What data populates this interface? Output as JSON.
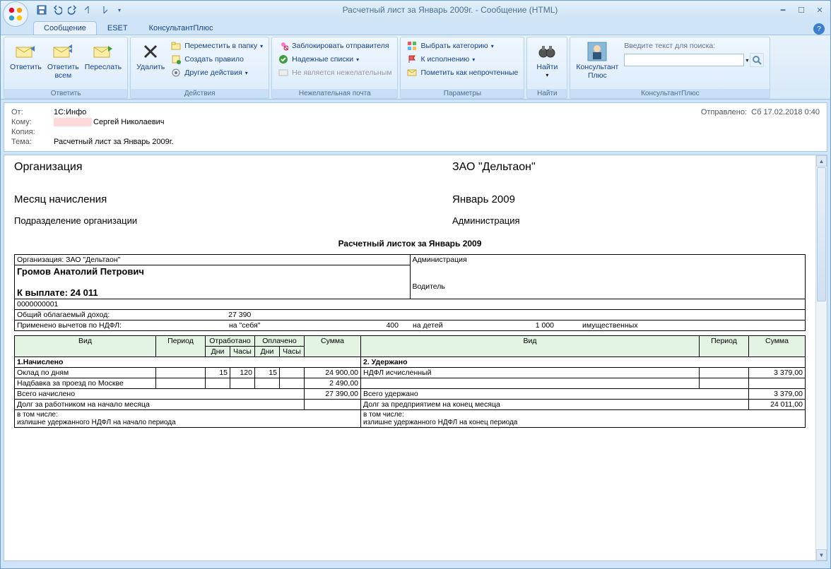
{
  "window": {
    "title": "Расчетный лист за Январь 2009г. - Сообщение (HTML)"
  },
  "tabs": {
    "msg": "Сообщение",
    "eset": "ESET",
    "kplus": "КонсультантПлюс"
  },
  "ribbon": {
    "reply_group": "Ответить",
    "reply": "Ответить",
    "reply_all": "Ответить\nвсем",
    "forward": "Переслать",
    "actions_group": "Действия",
    "delete": "Удалить",
    "move_folder": "Переместить в папку",
    "create_rule": "Создать правило",
    "other_actions": "Другие действия",
    "junk_group": "Нежелательная почта",
    "block_sender": "Заблокировать отправителя",
    "safe_lists": "Надежные списки",
    "not_junk": "Не является нежелательным",
    "params_group": "Параметры",
    "categorize": "Выбрать категорию",
    "followup": "К исполнению",
    "mark_unread": "Пометить как непрочтенные",
    "find_group": "Найти",
    "find": "Найти",
    "kplus_group": "КонсультантПлюс",
    "kplus_btn": "Консультант\nПлюс",
    "search_label": "Введите текст для поиска:"
  },
  "header": {
    "from_label": "От:",
    "from": "1С:Инфо",
    "to_label": "Кому:",
    "to_suffix": "Сергей Николаевич",
    "cc_label": "Копия:",
    "subject_label": "Тема:",
    "subject": "Расчетный лист за Январь 2009г.",
    "sent_label": "Отправлено:",
    "sent": "Сб 17.02.2018 0:40"
  },
  "doc": {
    "org_label": "Организация",
    "org": "ЗАО \"Дельтаон\"",
    "month_label": "Месяц начисления",
    "month": "Январь 2009",
    "dept_label": "Подразделение организации",
    "dept": "Администрация",
    "title": "Расчетный листок за Январь 2009",
    "org_line": "Организация: ЗАО \"Дельтаон\"",
    "dept2": "Администрация",
    "employee": "Громов Анатолий Петрович",
    "payout": "К выплате: 24 011",
    "position": "Водитель",
    "tabnum": "0000000001",
    "taxable_label": "Общий облагаемый доход:",
    "taxable": "27 390",
    "deduct_label": "Применено вычетов по НДФЛ:",
    "deduct_self_label": "на \"себя\"",
    "deduct_self": "400",
    "deduct_children_label": "на детей",
    "deduct_children": "1 000",
    "deduct_property_label": "имущественных",
    "col_type": "Вид",
    "col_period": "Период",
    "col_worked": "Отработано",
    "col_paid": "Оплачено",
    "col_days": "Дни",
    "col_hours": "Часы",
    "col_sum": "Сумма",
    "sec_accrued": "1.Начислено",
    "sec_withheld": "2. Удержано",
    "row_salary": "Оклад по дням",
    "row_salary_days": "15",
    "row_salary_hours": "120",
    "row_salary_pdays": "15",
    "row_salary_sum": "24 900,00",
    "row_ndfl": "НДФЛ исчисленный",
    "row_ndfl_sum": "3 379,00",
    "row_allowance": "Надбавка за проезд по Москве",
    "row_allowance_sum": "2 490,00",
    "row_total_accrued": "Всего начислено",
    "row_total_accrued_sum": "27 390,00",
    "row_total_withheld": "Всего удержано",
    "row_total_withheld_sum": "3 379,00",
    "row_debt_emp": "Долг за работником на начало месяца",
    "row_debt_org": "Долг за предприятием на конец месяца",
    "row_debt_org_sum": "24 011,00",
    "row_incl": "в том числе:\n  излишне удержанного НДФЛ на начало периода",
    "row_incl2": "в том числе:\n  излишне удержанного НДФЛ на конец периода"
  }
}
